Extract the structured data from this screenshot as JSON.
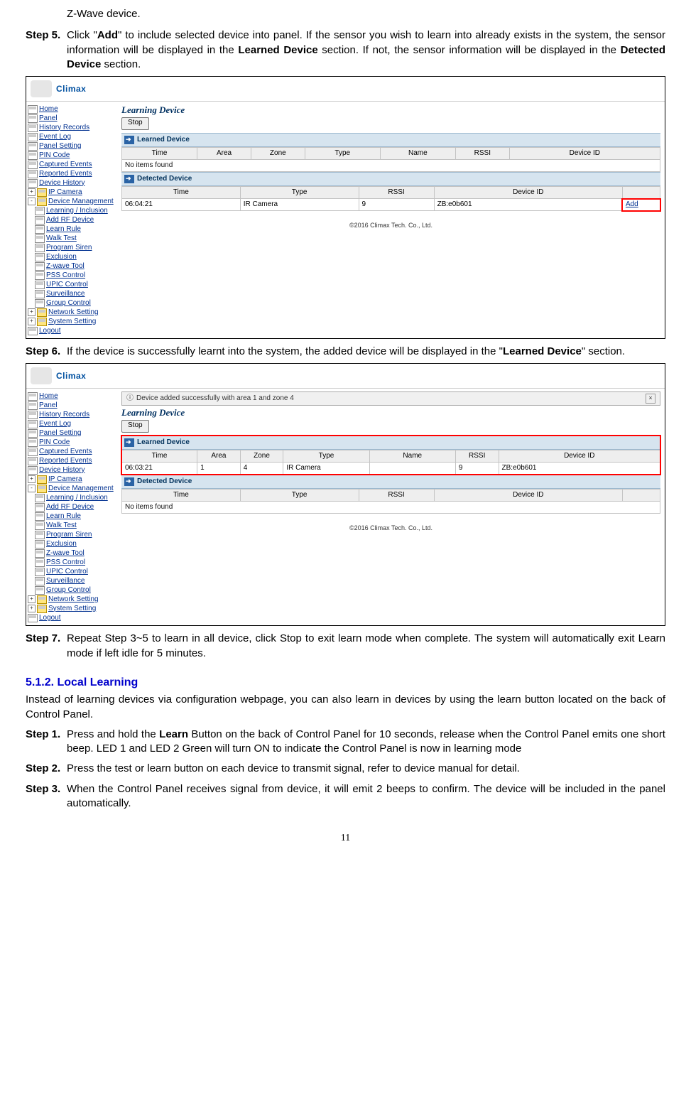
{
  "fragment_top": "Z-Wave device.",
  "step5": {
    "label": "Step 5.",
    "pre": "Click \"",
    "bold1": "Add",
    "mid1": "\" to include selected device into panel. If the sensor you wish to learn into already exists in the system, the sensor information will be displayed in the ",
    "bold2": "Learned Device",
    "mid2": " section. If not, the sensor information will be displayed in the ",
    "bold3": "Detected Device",
    "post": " section."
  },
  "logo_text": "Climax",
  "side": {
    "items": [
      "Home",
      "Panel",
      "History Records",
      "Event Log",
      "Panel Setting",
      "PIN Code",
      "Captured Events",
      "Reported Events",
      "Device History"
    ],
    "folder1": "IP Camera",
    "folder2": "Device Management",
    "sub": [
      "Learning / Inclusion",
      "Add RF Device",
      "Learn Rule",
      "Walk Test",
      "Program Siren",
      "Exclusion",
      "Z-wave Tool",
      "PSS Control",
      "UPIC Control",
      "Surveillance",
      "Group Control"
    ],
    "folder3": "Network Setting",
    "folder4": "System Setting",
    "last": "Logout"
  },
  "shot1": {
    "title": "Learning Device",
    "stop": "Stop",
    "learned_band": "Learned Device",
    "learned_headers": [
      "Time",
      "Area",
      "Zone",
      "Type",
      "Name",
      "RSSI",
      "Device ID"
    ],
    "noitems": "No items found",
    "detected_band": "Detected Device",
    "detected_headers": [
      "Time",
      "Type",
      "RSSI",
      "Device ID",
      ""
    ],
    "row": {
      "time": "06:04:21",
      "type": "IR Camera",
      "rssi": "9",
      "id": "ZB:e0b601",
      "add": "Add"
    },
    "foot": "©2016 Climax Tech. Co., Ltd."
  },
  "step6": {
    "label": "Step 6.",
    "pre": "If the device is successfully learnt into the system, the added device will be displayed in the \"",
    "bold": "Learned Device",
    "post": "\" section."
  },
  "shot2": {
    "notice": "Device added successfully with area 1 and zone 4",
    "title": "Learning Device",
    "stop": "Stop",
    "learned_band": "Learned Device",
    "learned_headers": [
      "Time",
      "Area",
      "Zone",
      "Type",
      "Name",
      "RSSI",
      "Device ID"
    ],
    "row": {
      "time": "06:03:21",
      "area": "1",
      "zone": "4",
      "type": "IR Camera",
      "name": "",
      "rssi": "9",
      "id": "ZB:e0b601"
    },
    "detected_band": "Detected Device",
    "detected_headers": [
      "Time",
      "Type",
      "RSSI",
      "Device ID",
      ""
    ],
    "noitems": "No items found",
    "foot": "©2016 Climax Tech. Co., Ltd."
  },
  "step7": {
    "label": "Step 7.",
    "text": "Repeat Step 3~5 to learn in all device, click Stop to exit learn mode when complete. The system will automatically exit Learn mode if left idle for 5 minutes."
  },
  "heading": "5.1.2. Local Learning",
  "intro": "Instead of learning devices via configuration webpage, you can also learn in devices by using the learn button located on the back of Control Panel.",
  "local_step1": {
    "label": "Step 1.",
    "pre": "Press and hold the ",
    "bold": "Learn",
    "post": " Button on the back of Control Panel for 10 seconds, release when the Control Panel emits one short beep. LED 1 and LED 2 Green will turn ON to indicate the Control Panel is now in learning mode"
  },
  "local_step2": {
    "label": "Step 2.",
    "text": "Press the test or learn button on each device to transmit signal, refer to device manual for detail."
  },
  "local_step3": {
    "label": "Step 3.",
    "text": "When the Control Panel receives signal from device, it will emit 2 beeps to confirm. The device will be included in the panel automatically."
  },
  "page": "11"
}
